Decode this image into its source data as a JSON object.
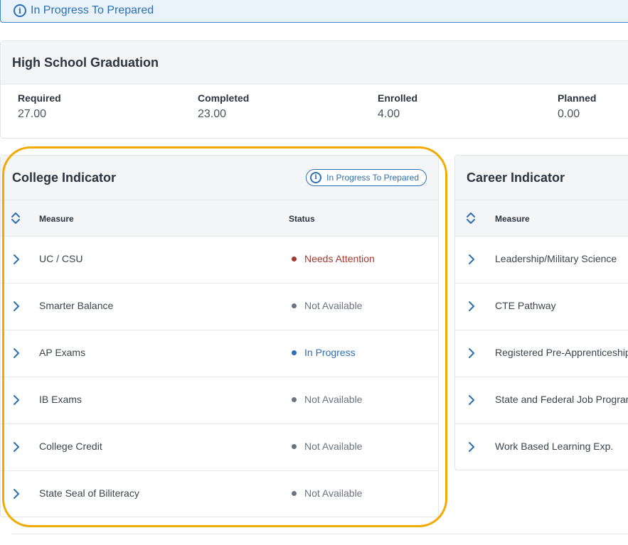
{
  "banner": {
    "text": "In Progress To Prepared",
    "icon": "info-icon"
  },
  "graduation": {
    "title": "High School Graduation",
    "stats": [
      {
        "label": "Required",
        "value": "27.00"
      },
      {
        "label": "Completed",
        "value": "23.00"
      },
      {
        "label": "Enrolled",
        "value": "4.00"
      },
      {
        "label": "Planned",
        "value": "0.00"
      }
    ]
  },
  "college": {
    "title": "College Indicator",
    "badge": "In Progress To Prepared",
    "columns": {
      "measure": "Measure",
      "status": "Status"
    },
    "rows": [
      {
        "measure": "UC / CSU",
        "status": "Needs Attention",
        "color": "#a33a2e"
      },
      {
        "measure": "Smarter Balance",
        "status": "Not Available",
        "color": "#6b7380"
      },
      {
        "measure": "AP Exams",
        "status": "In Progress",
        "color": "#2b6fb4"
      },
      {
        "measure": "IB Exams",
        "status": "Not Available",
        "color": "#6b7380"
      },
      {
        "measure": "College Credit",
        "status": "Not Available",
        "color": "#6b7380"
      },
      {
        "measure": "State Seal of Biliteracy",
        "status": "Not Available",
        "color": "#6b7380"
      }
    ]
  },
  "career": {
    "title": "Career Indicator",
    "columns": {
      "measure": "Measure"
    },
    "rows": [
      {
        "measure": "Leadership/Military Science"
      },
      {
        "measure": "CTE Pathway"
      },
      {
        "measure": "Registered Pre-Apprenticeship"
      },
      {
        "measure": "State and Federal Job Program"
      },
      {
        "measure": "Work Based Learning Exp."
      }
    ]
  },
  "colors": {
    "accent": "#2b6fb4",
    "highlight": "#f2a900",
    "alert": "#a33a2e",
    "neutral": "#6b7380"
  }
}
